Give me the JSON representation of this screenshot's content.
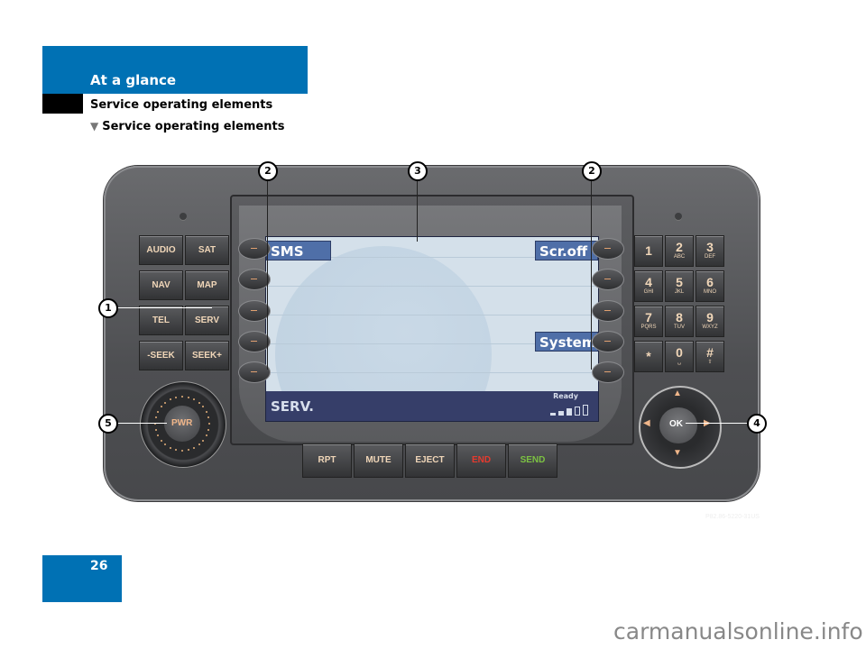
{
  "header": {
    "section": "At a glance",
    "subsection": "Service operating elements",
    "heading": "Service operating elements",
    "heading_marker": "▼"
  },
  "page_number": "26",
  "watermark": "carmanualsonline.info",
  "figure_code": "P82.86-5220-31US",
  "colors": {
    "brand_blue": "#0071b4",
    "screen_label": "#4f6fa8",
    "status_bar": "#363e69"
  },
  "device": {
    "left_buttons": [
      "AUDIO",
      "SAT",
      "NAV",
      "MAP",
      "TEL",
      "SERV",
      "-SEEK",
      "SEEK+"
    ],
    "keypad": [
      {
        "num": "1",
        "sub": ""
      },
      {
        "num": "2",
        "sub": "ABC"
      },
      {
        "num": "3",
        "sub": "DEF"
      },
      {
        "num": "4",
        "sub": "GHI"
      },
      {
        "num": "5",
        "sub": "JKL"
      },
      {
        "num": "6",
        "sub": "MNO"
      },
      {
        "num": "7",
        "sub": "PQRS"
      },
      {
        "num": "8",
        "sub": "TUV"
      },
      {
        "num": "9",
        "sub": "WXYZ"
      },
      {
        "num": "*",
        "sub": ""
      },
      {
        "num": "0",
        "sub": "␣"
      },
      {
        "num": "#",
        "sub": "⇧"
      }
    ],
    "bottom_buttons": [
      {
        "label": "RPT",
        "color": "#f0d6b8"
      },
      {
        "label": "MUTE",
        "color": "#f0d6b8"
      },
      {
        "label": "EJECT",
        "color": "#f0d6b8"
      },
      {
        "label": "END",
        "color": "#e63a2e"
      },
      {
        "label": "SEND",
        "color": "#7cc242"
      }
    ],
    "knob_label": "PWR",
    "ok_label": "OK",
    "screen": {
      "left_softkeys": [
        "SMS"
      ],
      "right_softkeys": [
        "Scr.off",
        "System"
      ],
      "status_title": "SERV.",
      "status_text": "Ready",
      "signal_level": 3,
      "signal_max": 5
    }
  },
  "callouts": [
    "1",
    "2",
    "3",
    "2",
    "4",
    "5"
  ]
}
